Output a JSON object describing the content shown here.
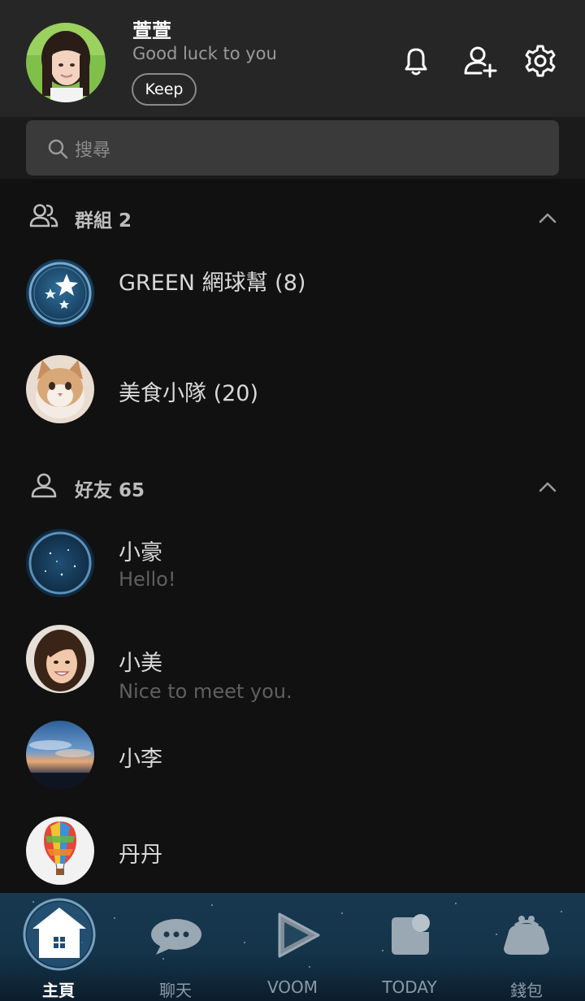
{
  "profile": {
    "name": "萱萱",
    "status": "Good luck to you",
    "keep_label": "Keep"
  },
  "header_icons": [
    "bell-icon",
    "add-friend-icon",
    "settings-icon"
  ],
  "search": {
    "placeholder": "搜尋"
  },
  "groups": {
    "title": "群組 2",
    "items": [
      {
        "name": "GREEN 網球幫 (8)",
        "avatar": "starry-sky"
      },
      {
        "name": "美食小隊 (20)",
        "avatar": "cat"
      }
    ]
  },
  "friends": {
    "title": "好友 65",
    "items": [
      {
        "name": "小豪",
        "status": "Hello!",
        "avatar": "starry-sky"
      },
      {
        "name": "小美",
        "status": "Nice to meet you.",
        "avatar": "woman"
      },
      {
        "name": "小李",
        "status": "",
        "avatar": "sunset-city"
      },
      {
        "name": "丹丹",
        "status": "",
        "avatar": "hot-air-balloon"
      }
    ]
  },
  "tabs": [
    {
      "label": "主頁",
      "icon": "home-icon",
      "active": true
    },
    {
      "label": "聊天",
      "icon": "chat-icon",
      "active": false
    },
    {
      "label": "VOOM",
      "icon": "play-icon",
      "active": false
    },
    {
      "label": "TODAY",
      "icon": "today-icon",
      "active": false
    },
    {
      "label": "錢包",
      "icon": "wallet-icon",
      "active": false
    }
  ],
  "colors": {
    "background": "#111111",
    "header": "#262626",
    "tabbar": "#14344a"
  }
}
